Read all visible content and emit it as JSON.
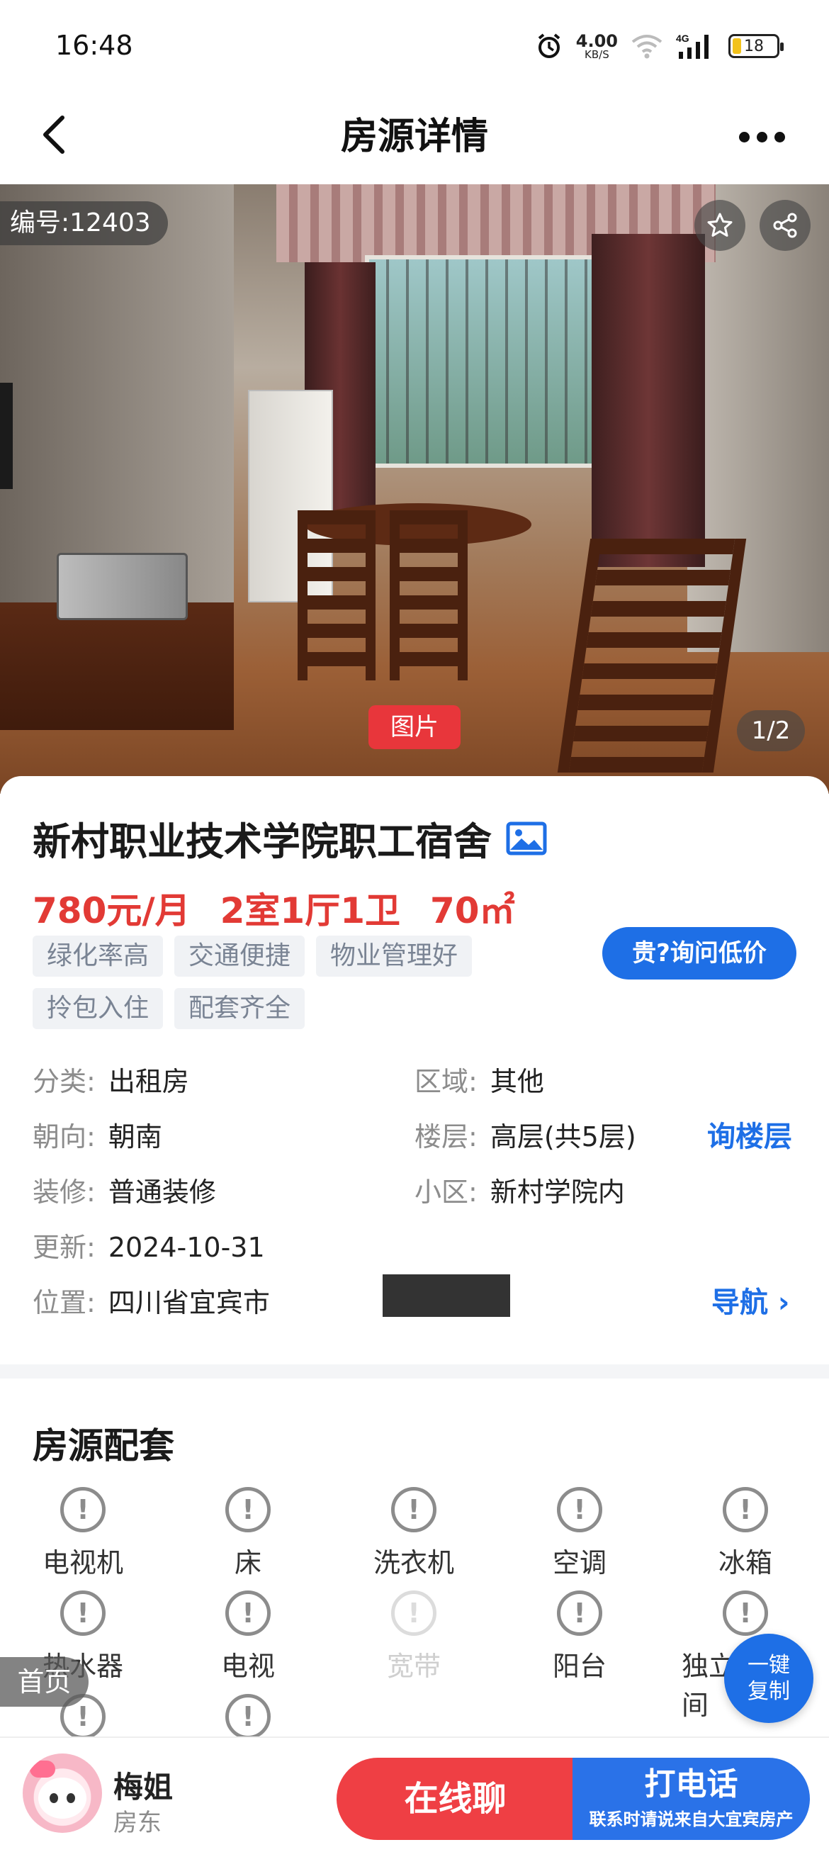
{
  "status_bar": {
    "time": "16:48",
    "net_speed": "4.00",
    "net_unit": "KB/S",
    "network": "4G",
    "battery": "18"
  },
  "nav": {
    "title": "房源详情"
  },
  "photo": {
    "id_label": "编号:12403",
    "tag": "图片",
    "counter": "1/2"
  },
  "listing": {
    "title": "新村职业技术学院职工宿舍",
    "price": "780元/月",
    "layout": "2室1厅1卫",
    "area": "70㎡",
    "tags": [
      "绿化率高",
      "交通便捷",
      "物业管理好",
      "拎包入住",
      "配套齐全"
    ],
    "ask_price_label": "贵?询问低价",
    "attrs": {
      "category_k": "分类:",
      "category_v": "出租房",
      "region_k": "区域:",
      "region_v": "其他",
      "facing_k": "朝向:",
      "facing_v": "朝南",
      "floor_k": "楼层:",
      "floor_v": "高层(共5层)",
      "decor_k": "装修:",
      "decor_v": "普通装修",
      "community_k": "小区:",
      "community_v": "新村学院内",
      "updated_k": "更新:",
      "updated_v": "2024-10-31",
      "location_k": "位置:",
      "location_v": "四川省宜宾市"
    },
    "ask_floor_label": "询楼层",
    "navigate_label": "导航 ›"
  },
  "facilities": {
    "title": "房源配套",
    "items": [
      {
        "label": "电视机",
        "available": true
      },
      {
        "label": "床",
        "available": true
      },
      {
        "label": "洗衣机",
        "available": true
      },
      {
        "label": "空调",
        "available": true
      },
      {
        "label": "冰箱",
        "available": true
      },
      {
        "label": "热水器",
        "available": true
      },
      {
        "label": "电视",
        "available": true
      },
      {
        "label": "宽带",
        "available": false
      },
      {
        "label": "阳台",
        "available": true
      },
      {
        "label": "独立卫生间",
        "available": true
      }
    ],
    "icon_glyph": "!"
  },
  "floating": {
    "home_label": "首页",
    "copy_line1": "一键",
    "copy_line2": "复制"
  },
  "bottom": {
    "owner_name": "梅姐",
    "owner_role": "房东",
    "chat_label": "在线聊",
    "call_label": "打电话",
    "call_sub": "联系时请说来自大宜宾房产"
  },
  "colors": {
    "price_red": "#e23a35",
    "accent_blue": "#1e6fe6",
    "chat_red": "#ef3f44"
  }
}
